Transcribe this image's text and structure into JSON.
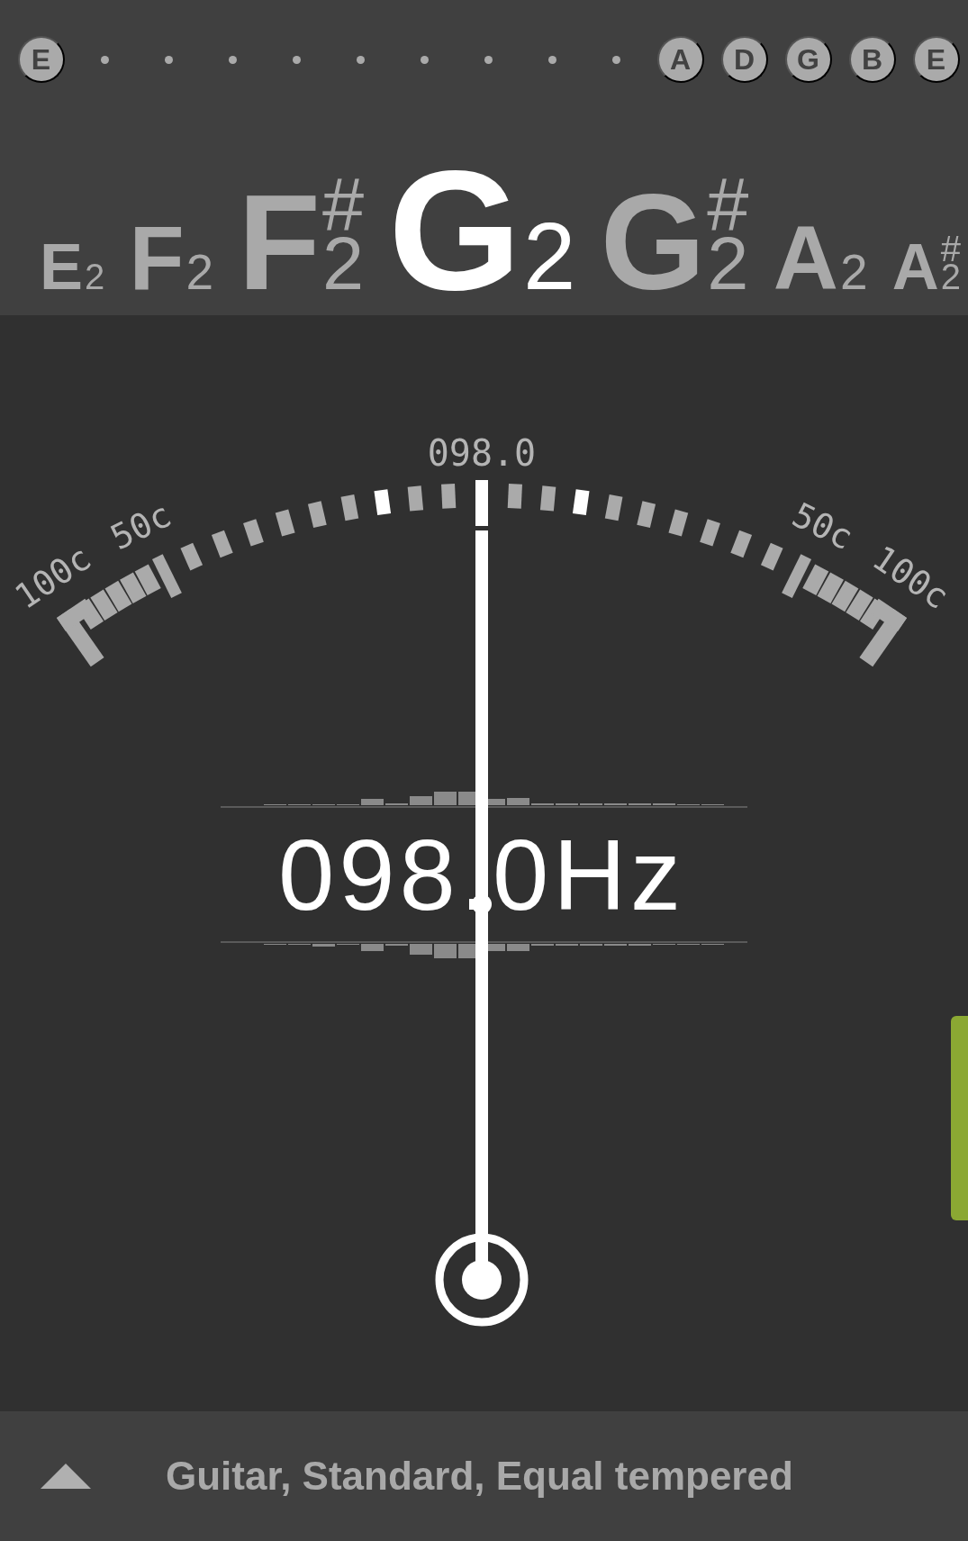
{
  "tuning_strings": [
    {
      "kind": "string",
      "label": "E"
    },
    {
      "kind": "dot"
    },
    {
      "kind": "dot"
    },
    {
      "kind": "dot"
    },
    {
      "kind": "dot"
    },
    {
      "kind": "dot"
    },
    {
      "kind": "dot"
    },
    {
      "kind": "dot"
    },
    {
      "kind": "dot"
    },
    {
      "kind": "dot"
    },
    {
      "kind": "string",
      "label": "A"
    },
    {
      "kind": "string",
      "label": "D"
    },
    {
      "kind": "string",
      "label": "G"
    },
    {
      "kind": "string",
      "label": "B"
    },
    {
      "kind": "string",
      "label": "E"
    }
  ],
  "notes": [
    {
      "name": "E",
      "octave": "2",
      "selected": false
    },
    {
      "name": "F",
      "octave": "2",
      "selected": false
    },
    {
      "name": "F",
      "accidental": "#",
      "octave": "2",
      "selected": false
    },
    {
      "name": "G",
      "octave": "2",
      "selected": true
    },
    {
      "name": "G",
      "accidental": "#",
      "octave": "2",
      "selected": false
    },
    {
      "name": "A",
      "octave": "2",
      "selected": false
    },
    {
      "name": "A",
      "accidental": "#",
      "octave": "2",
      "selected": false
    }
  ],
  "meter": {
    "reading": "098.0",
    "scale_labels": [
      "100c",
      "50c",
      "50c",
      "100c"
    ]
  },
  "frequency": "098.0Hz",
  "tuning_preset": "Guitar, Standard, Equal tempered"
}
